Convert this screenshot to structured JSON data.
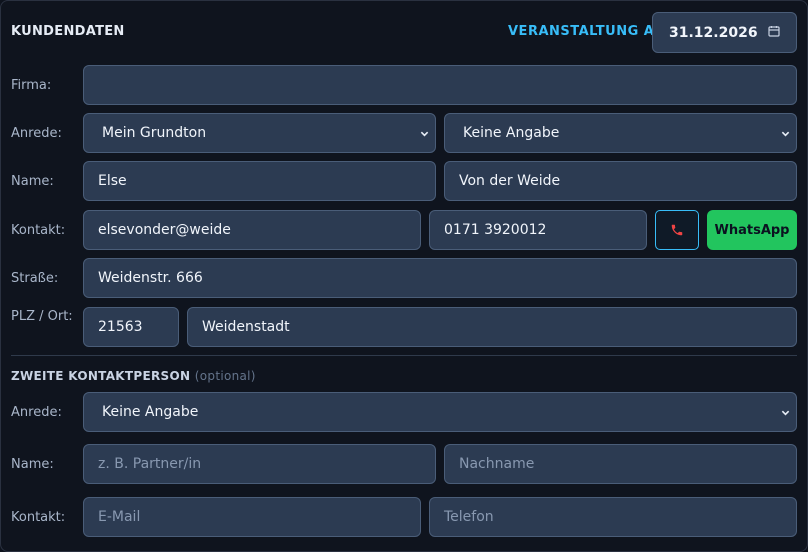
{
  "header": {
    "title": "KUNDENDATEN",
    "event_label": "VERANSTALTUNG AM",
    "event_date": "31.12.2026",
    "calendar_icon": "calendar-icon"
  },
  "customer": {
    "company": {
      "label": "Firma:",
      "value": ""
    },
    "salutation": {
      "label": "Anrede:",
      "greeting_selected": "Mein Grundton",
      "gender_selected": "Keine Angabe"
    },
    "name": {
      "label": "Name:",
      "first": "Else",
      "last": "Von der Weide"
    },
    "contact": {
      "label": "Kontakt:",
      "email": "elsevonder@weide",
      "phone": "0171 3920012",
      "call_icon": "phone-icon",
      "whatsapp_label": "WhatsApp"
    },
    "street": {
      "label": "Straße:",
      "value": "Weidenstr. 666"
    },
    "city": {
      "label": "PLZ / Ort:",
      "zip": "21563",
      "city": "Weidenstadt"
    }
  },
  "second_contact": {
    "title": "ZWEITE KONTAKTPERSON",
    "optional": "(optional)",
    "salutation": {
      "label": "Anrede:",
      "selected": "Keine Angabe"
    },
    "name": {
      "label": "Name:",
      "first_placeholder": "z. B. Partner/in",
      "last_placeholder": "Nachname"
    },
    "contact": {
      "label": "Kontakt:",
      "email_placeholder": "E-Mail",
      "phone_placeholder": "Telefon"
    }
  },
  "colors": {
    "accent": "#38bdf8",
    "whatsapp": "#22c55e",
    "call_icon": "#ef4444",
    "field_bg": "#2c3b52"
  }
}
